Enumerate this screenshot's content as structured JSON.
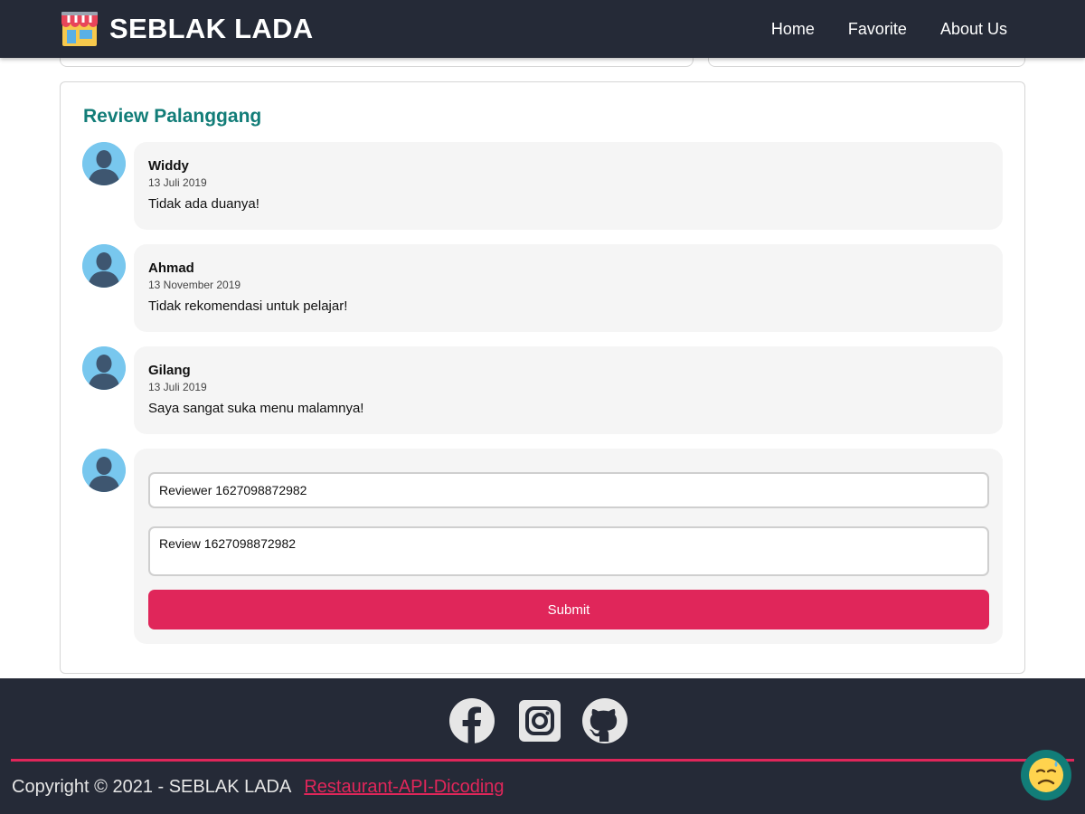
{
  "header": {
    "brand_icon": "store-icon",
    "title": "SEBLAK LADA",
    "nav": [
      {
        "label": "Home"
      },
      {
        "label": "Favorite"
      },
      {
        "label": "About Us"
      }
    ]
  },
  "reviews": {
    "title": "Review Palanggang",
    "items": [
      {
        "name": "Widdy",
        "date": "13 Juli 2019",
        "text": "Tidak ada duanya!"
      },
      {
        "name": "Ahmad",
        "date": "13 November 2019",
        "text": "Tidak rekomendasi untuk pelajar!"
      },
      {
        "name": "Gilang",
        "date": "13 Juli 2019",
        "text": "Saya sangat suka menu malamnya!"
      }
    ],
    "form": {
      "name_value": "Reviewer 1627098872982",
      "review_value": "Review 1627098872982",
      "submit_label": "Submit"
    }
  },
  "footer": {
    "socials": [
      {
        "icon": "facebook-icon"
      },
      {
        "icon": "instagram-icon"
      },
      {
        "icon": "github-icon"
      }
    ],
    "copyright": "Copyright © 2021 - SEBLAK LADA",
    "link_label": "Restaurant-API-Dicoding"
  },
  "floating_button": {
    "icon": "sad-face-icon"
  },
  "colors": {
    "header_bg": "#252a37",
    "accent": "#e0265a",
    "teal": "#127d78"
  }
}
